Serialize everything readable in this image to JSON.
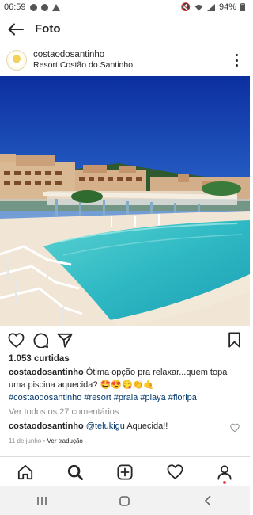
{
  "status_bar": {
    "time": "06:59",
    "battery": "94%",
    "left_icons": [
      "message-icon",
      "spotify-icon",
      "warning-icon"
    ],
    "right_icons": [
      "mute-icon",
      "wifi-icon",
      "signal-icon"
    ]
  },
  "app_bar": {
    "title": "Foto",
    "back_icon": "back-arrow-icon"
  },
  "post": {
    "username": "costaodosantinho",
    "location": "Resort Costão do Santinho",
    "more_icon": "more-vertical-icon",
    "photo_subject": "resort pool with buildings",
    "likes": "1.053 curtidas",
    "caption_user": "costaodosantinho",
    "caption_text": "Ótima opção pra relaxar...quem topa uma piscina aquecida? 🤩😍😋👏🤙",
    "hashtags": "#costaodosantinho #resort #praia #playa #floripa",
    "view_comments": "Ver todos os 27 comentários",
    "comment_user": "costaodosantinho",
    "comment_mention": "@telukigu",
    "comment_text": "Aquecida!!",
    "date": "11 de junho",
    "separator": "•",
    "translate": "Ver tradução"
  },
  "actions": [
    "heart-icon",
    "comment-icon",
    "share-icon",
    "bookmark-icon"
  ],
  "bottom_nav": [
    "home-icon",
    "search-icon",
    "add-post-icon",
    "activity-heart-icon",
    "profile-icon"
  ],
  "system_nav": [
    "recent-apps-icon",
    "home-button-icon",
    "back-button-icon"
  ],
  "colors": {
    "text": "#262626",
    "secondary_text": "#8e8e8e",
    "link": "#00376b",
    "divider": "#dbdbdb",
    "notification": "#ed4956"
  }
}
